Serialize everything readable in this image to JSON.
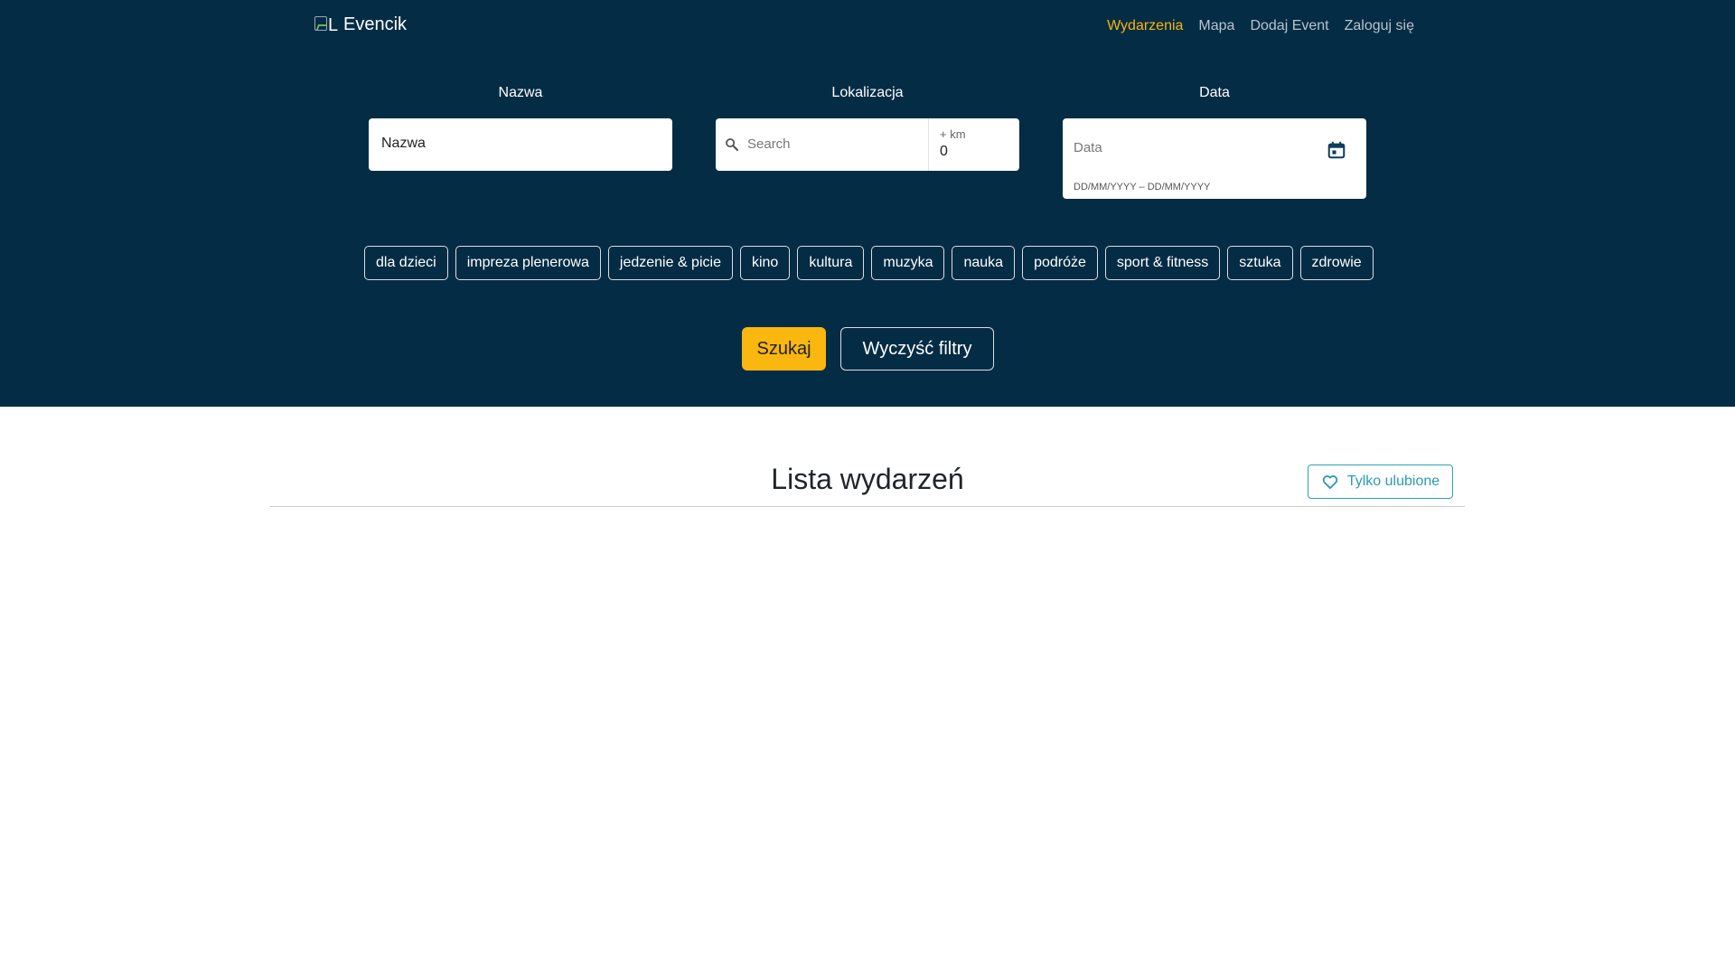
{
  "header": {
    "logo_alt": "L",
    "brand": "Evencik",
    "nav": [
      {
        "label": "Wydarzenia",
        "active": true
      },
      {
        "label": "Mapa",
        "active": false
      },
      {
        "label": "Dodaj Event",
        "active": false
      },
      {
        "label": "Zaloguj się",
        "active": false
      }
    ]
  },
  "filters": {
    "name": {
      "label": "Nazwa",
      "value": "Nazwa"
    },
    "location": {
      "label": "Lokalizacja",
      "placeholder": "Search",
      "km_label": "+ km",
      "km_value": "0"
    },
    "date": {
      "label": "Data",
      "placeholder": "Data",
      "hint": "DD/MM/YYYY – DD/MM/YYYY"
    },
    "categories": [
      "dla dzieci",
      "impreza plenerowa",
      "jedzenie & picie",
      "kino",
      "kultura",
      "muzyka",
      "nauka",
      "podróże",
      "sport & fitness",
      "sztuka",
      "zdrowie"
    ],
    "search_button": "Szukaj",
    "clear_button": "Wyczyść filtry"
  },
  "list": {
    "title": "Lista wydarzeń",
    "favorites_button": "Tylko ulubione"
  },
  "colors": {
    "hero_bg": "#052c45",
    "accent": "#f9b70f",
    "fav_accent": "#2aa3b8"
  }
}
